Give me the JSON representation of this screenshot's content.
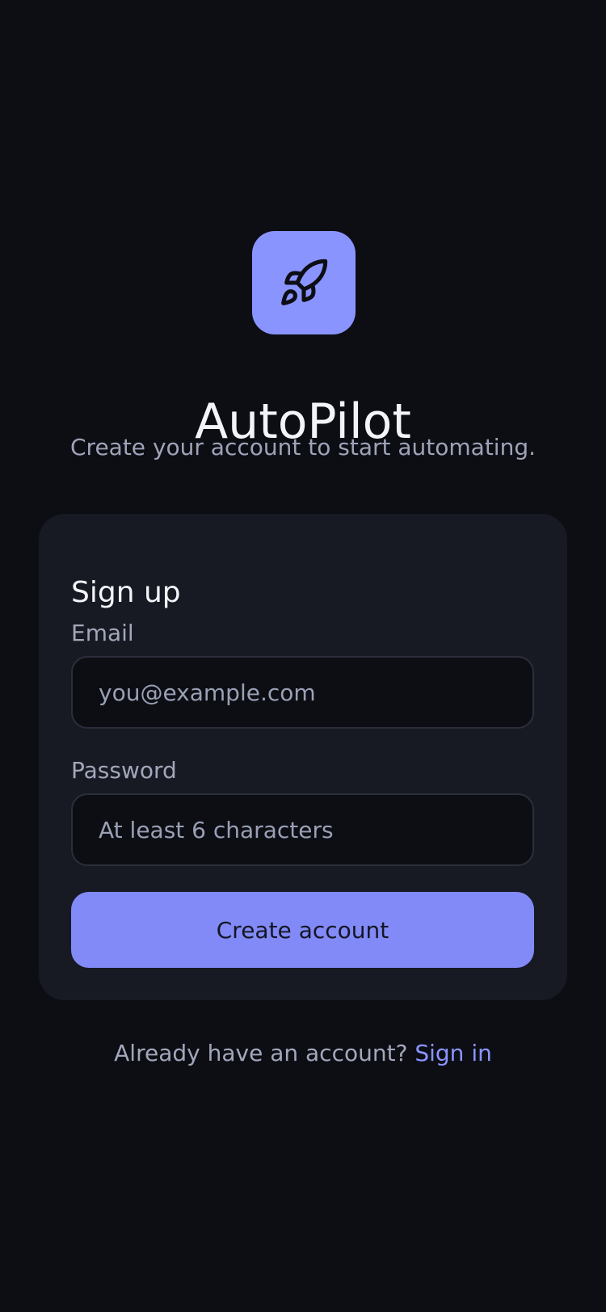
{
  "app": {
    "title": "AutoPilot",
    "tagline": "Create your account to start automating.",
    "logo_icon": "rocket-icon",
    "accent_color": "#8a94ff",
    "background_color": "#0d0e14",
    "card_color": "#171923"
  },
  "form": {
    "title": "Sign up",
    "email_label": "Email",
    "email_placeholder": "you@example.com",
    "email_value": "",
    "password_label": "Password",
    "password_placeholder": "At least 6 characters",
    "password_value": "",
    "submit_label": "Create account"
  },
  "footer": {
    "prompt": "Already have an account?",
    "link_label": "Sign in"
  }
}
